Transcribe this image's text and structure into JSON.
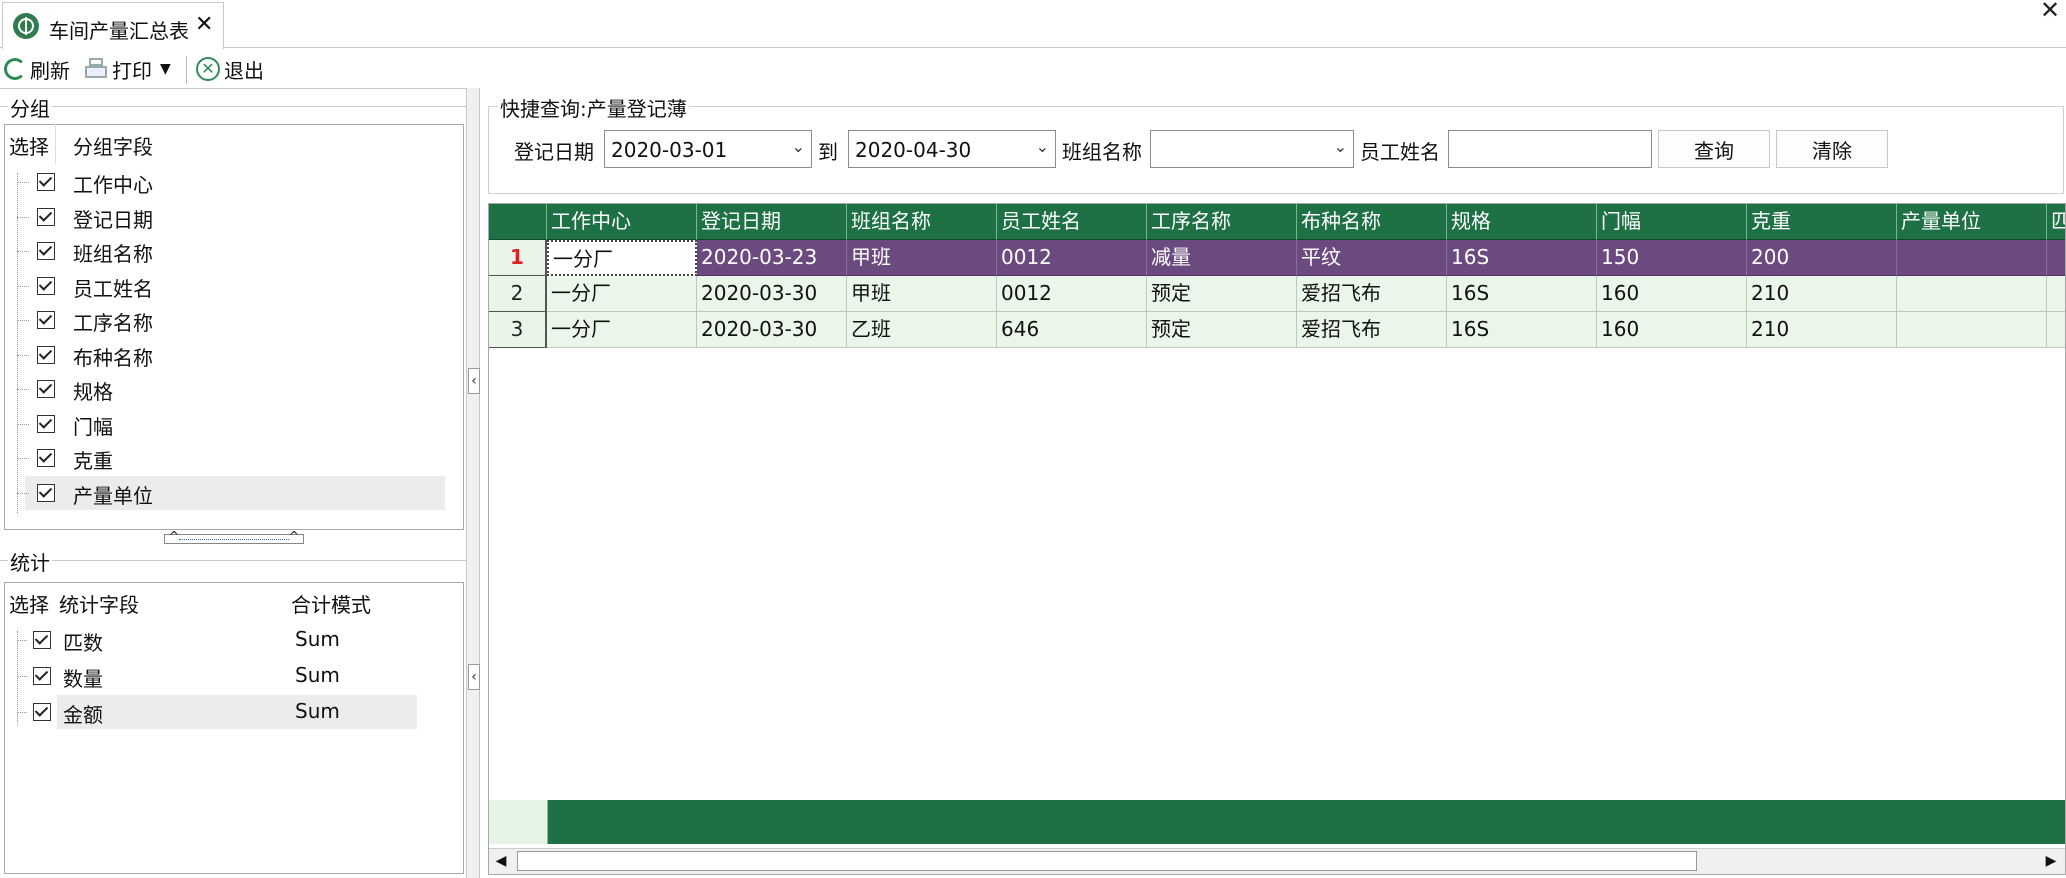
{
  "tab": {
    "title": "车间产量汇总表",
    "close": "✕"
  },
  "window": {
    "close": "✕"
  },
  "toolbar": {
    "refresh": "刷新",
    "print": "打印",
    "exit": "退出"
  },
  "group_panel": {
    "title": "分组",
    "col_select": "选择",
    "col_field": "分组字段",
    "items": [
      "工作中心",
      "登记日期",
      "班组名称",
      "员工姓名",
      "工序名称",
      "布种名称",
      "规格",
      "门幅",
      "克重",
      "产量单位"
    ]
  },
  "stat_panel": {
    "title": "统计",
    "col_select": "选择",
    "col_field": "统计字段",
    "col_mode": "合计模式",
    "items": [
      {
        "field": "匹数",
        "mode": "Sum"
      },
      {
        "field": "数量",
        "mode": "Sum"
      },
      {
        "field": "金额",
        "mode": "Sum"
      }
    ]
  },
  "query": {
    "title": "快捷查询:产量登记薄",
    "date_label": "登记日期",
    "date_from": "2020-03-01",
    "to_label": "到",
    "date_to": "2020-04-30",
    "team_label": "班组名称",
    "team_value": "",
    "employee_label": "员工姓名",
    "employee_value": "",
    "search_button": "查询",
    "clear_button": "清除"
  },
  "grid": {
    "columns": [
      "工作中心",
      "登记日期",
      "班组名称",
      "员工姓名",
      "工序名称",
      "布种名称",
      "规格",
      "门幅",
      "克重",
      "产量单位",
      "匹"
    ],
    "rows": [
      {
        "num": "1",
        "cells": [
          "一分厂",
          "2020-03-23",
          "甲班",
          "0012",
          "减量",
          "平纹",
          "16S",
          "150",
          "200",
          ""
        ]
      },
      {
        "num": "2",
        "cells": [
          "一分厂",
          "2020-03-30",
          "甲班",
          "0012",
          "预定",
          "爱招飞布",
          "16S",
          "160",
          "210",
          ""
        ]
      },
      {
        "num": "3",
        "cells": [
          "一分厂",
          "2020-03-30",
          "乙班",
          "646",
          "预定",
          "爱招飞布",
          "16S",
          "160",
          "210",
          ""
        ]
      }
    ]
  }
}
